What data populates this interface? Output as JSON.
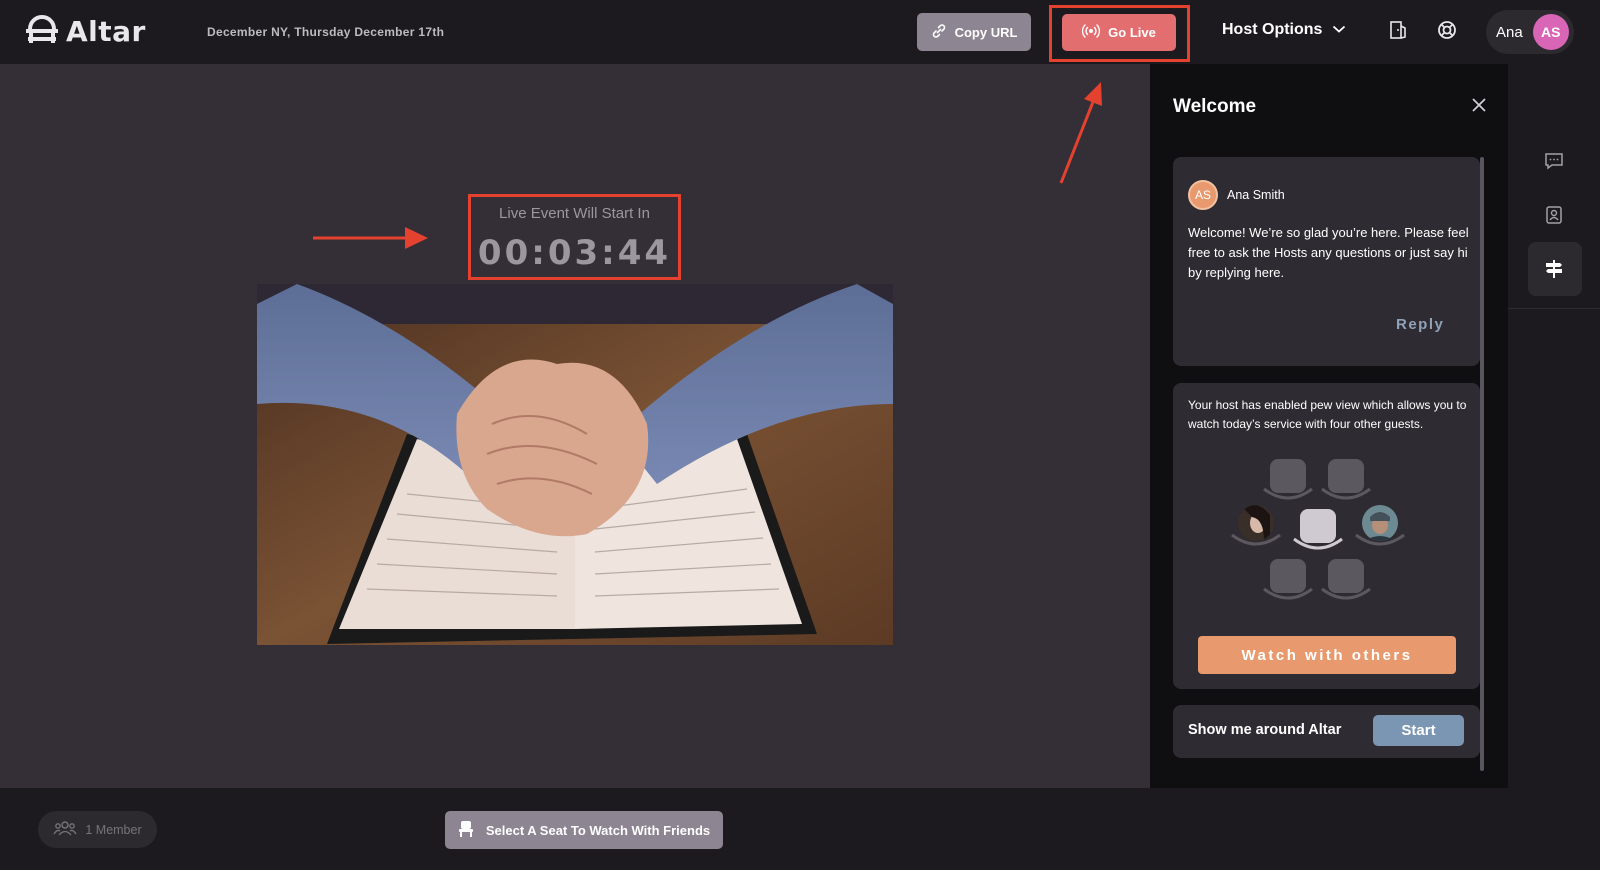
{
  "app": {
    "logo_text": "Altar"
  },
  "header": {
    "date": "December NY, Thursday December 17th",
    "copy_url_label": "Copy URL",
    "go_live_label": "Go Live",
    "host_options_label": "Host Options",
    "user_name": "Ana",
    "user_initials": "AS"
  },
  "stage": {
    "countdown_label": "Live Event Will Start In",
    "countdown_value": "00:03:44"
  },
  "panel": {
    "title": "Welcome",
    "message": {
      "author_initials": "AS",
      "author": "Ana Smith",
      "text": "Welcome! We’re so glad you’re here. Please feel free to ask the Hosts any questions or just say hi by replying here.",
      "reply_label": "Reply"
    },
    "pew": {
      "text": "Your host has enabled pew view which allows you to watch today’s service with four other guests.",
      "watch_label": "Watch with others"
    },
    "tour": {
      "text": "Show me around Altar",
      "start_label": "Start"
    }
  },
  "footer": {
    "members_label": "1 Member",
    "seat_label": "Select A Seat To Watch With Friends"
  },
  "colors": {
    "go_live": "#e26e70",
    "accent_orange": "#e89a6e",
    "start_blue": "#7b96b3",
    "avatar_pink": "#d865b6",
    "annotation_red": "#e4412f"
  }
}
